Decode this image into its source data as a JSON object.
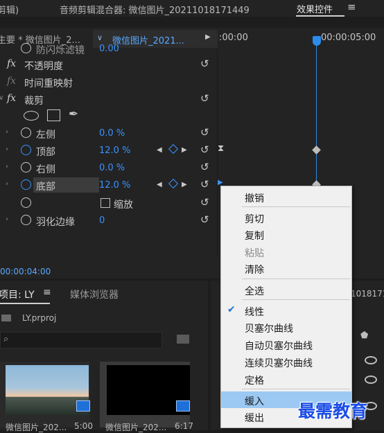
{
  "top_bar": {
    "left_text": "剪辑)",
    "mixer_title": "音频剪辑混合器: 微信图片_20211018171449",
    "active_tab": "效果控件",
    "menu_icon": "hamburger-icon"
  },
  "effect_controls": {
    "source_label": "主要 * 微信图片_2...",
    "clip_label": "微信图片_2021...",
    "timecode_start": ":00:00",
    "timecode_playhead": "00:00:05:00",
    "rows": [
      {
        "label": "防闪烁滤镜",
        "value": "0.00"
      },
      {
        "label": "不透明度"
      },
      {
        "label": "时间重映射"
      },
      {
        "label": "裁剪"
      },
      {
        "label": "左侧",
        "value": "0.0 %"
      },
      {
        "label": "顶部",
        "value": "12.0 %"
      },
      {
        "label": "右侧",
        "value": "0.0 %"
      },
      {
        "label": "底部",
        "value": "12.0 %"
      },
      {
        "label": "缩放"
      },
      {
        "label": "羽化边缘",
        "value": "0"
      }
    ],
    "fx_symbol": "fx",
    "bottom_timecode": "00:00:04:00"
  },
  "project_panel": {
    "tab_label": "项目: LY",
    "media_browser_label": "媒体浏览器",
    "project_file": "LY.prproj",
    "items": [
      {
        "name": "微信图片_202...",
        "duration": "5:00"
      },
      {
        "name": "微信图片_202...",
        "duration": "6:17"
      }
    ]
  },
  "right_panel": {
    "partial_text": "1018171"
  },
  "context_menu": {
    "items": [
      {
        "label": "撤销",
        "enabled": true
      },
      {
        "label": "剪切",
        "enabled": true
      },
      {
        "label": "复制",
        "enabled": true
      },
      {
        "label": "粘贴",
        "enabled": false
      },
      {
        "label": "清除",
        "enabled": true
      },
      {
        "label": "全选",
        "enabled": true
      },
      {
        "label": "线性",
        "enabled": true,
        "checked": true
      },
      {
        "label": "贝塞尔曲线",
        "enabled": true
      },
      {
        "label": "自动贝塞尔曲线",
        "enabled": true
      },
      {
        "label": "连续贝塞尔曲线",
        "enabled": true
      },
      {
        "label": "定格",
        "enabled": true
      },
      {
        "label": "缓入",
        "enabled": true,
        "highlighted": true
      },
      {
        "label": "缓出",
        "enabled": true
      }
    ]
  },
  "watermark": "最需教育",
  "colors": {
    "accent": "#2d8ceb",
    "value_blue": "#3a93ff",
    "menu_highlight": "#9bc9f3"
  }
}
